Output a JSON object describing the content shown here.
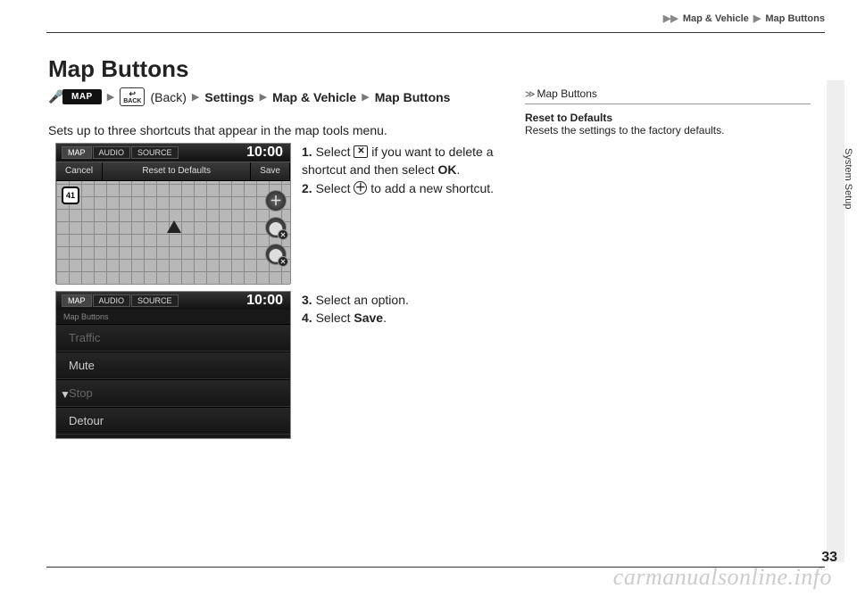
{
  "header": {
    "breadcrumb_parent": "Map & Vehicle",
    "breadcrumb_current": "Map Buttons"
  },
  "side_section": "System Setup",
  "page": {
    "title": "Map Buttons",
    "breadcrumb": {
      "map_label": "MAP",
      "back_label": "BACK",
      "back_text": "(Back)",
      "settings": "Settings",
      "mapvehicle": "Map & Vehicle",
      "mapbuttons": "Map Buttons"
    },
    "intro": "Sets up to three shortcuts that appear in the map tools menu."
  },
  "shot1": {
    "tab_map": "MAP",
    "tab_audio": "AUDIO",
    "tab_source": "SOURCE",
    "clock": "10:00",
    "cancel": "Cancel",
    "reset": "Reset to Defaults",
    "save": "Save",
    "route": "41"
  },
  "shot2": {
    "tab_map": "MAP",
    "tab_audio": "AUDIO",
    "tab_source": "SOURCE",
    "clock": "10:00",
    "subheader": "Map Buttons",
    "items": [
      "Traffic",
      "Mute",
      "Stop",
      "Detour"
    ]
  },
  "steps1": {
    "s1a": "Select ",
    "s1b": " if you want to delete a shortcut and then select ",
    "s1c": "OK",
    "s1d": ".",
    "s2a": "Select ",
    "s2b": " to add a new shortcut."
  },
  "steps2": {
    "s3": "Select an option.",
    "s4a": "Select ",
    "s4b": "Save",
    "s4c": "."
  },
  "note": {
    "heading": "Map Buttons",
    "title": "Reset to Defaults",
    "body": "Resets the settings to the factory defaults."
  },
  "footer": {
    "watermark": "carmanualsonline.info",
    "page_number": "33"
  },
  "labels": {
    "n1": "1.",
    "n2": "2.",
    "n3": "3.",
    "n4": "4."
  }
}
